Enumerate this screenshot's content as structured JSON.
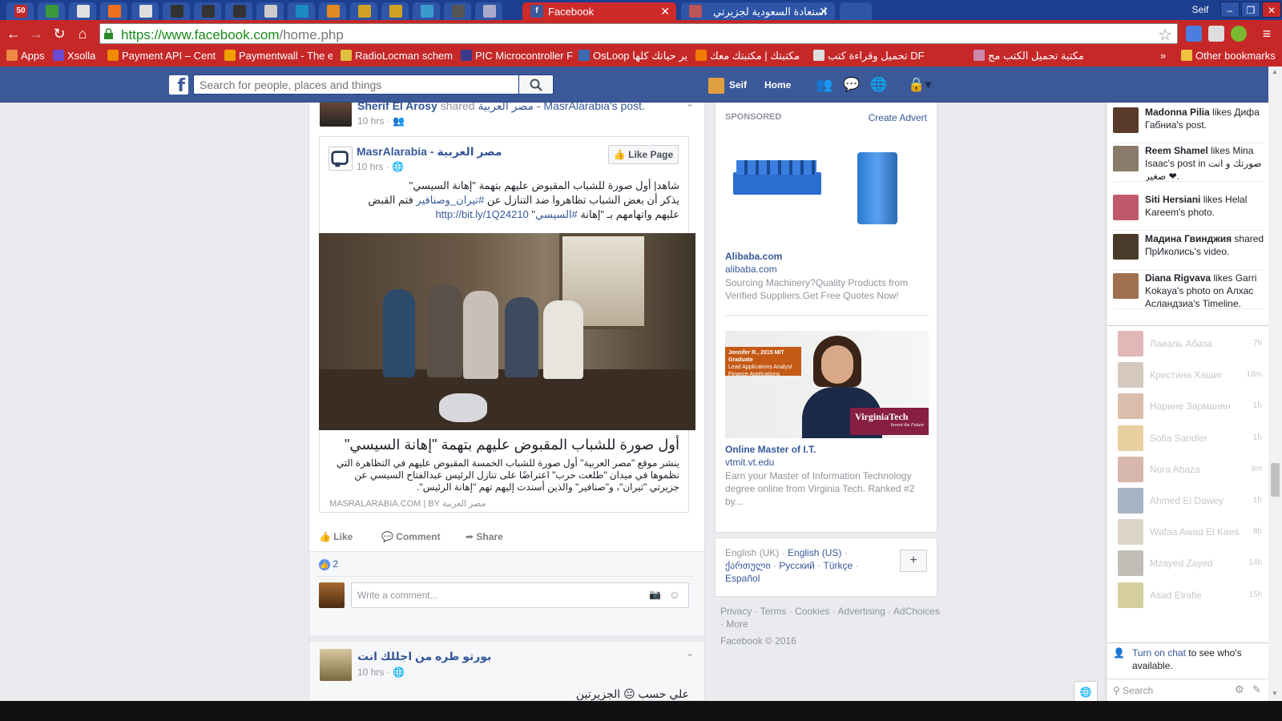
{
  "tabs": {
    "small": [
      "50",
      "",
      "",
      "",
      "",
      "",
      "",
      "",
      "",
      "",
      "",
      "",
      "",
      "",
      "",
      ""
    ],
    "active_tab": "Facebook",
    "second_tab": "استعادة السعودية لجزيرتي",
    "profile": "Seif"
  },
  "toolbar": {
    "url_main": "https://www.facebook.com",
    "url_path": "/home.php"
  },
  "bookmarks": {
    "items": [
      "Apps",
      "Xsolla",
      "Payment API – Centi",
      "Paymentwall - The e",
      "RadioLocman schem",
      "PIC Microcontroller F",
      "OsLoop ير حياتك كلها",
      "مكتبتك | مكتبتك معك",
      "تحميل وقراءة كتب DF",
      "مكتبة تحميل الكتب مج"
    ],
    "overflow": "»",
    "other": "Other bookmarks"
  },
  "fbbar": {
    "search_placeholder": "Search for people, places and things",
    "user": "Seif",
    "home": "Home"
  },
  "feed": {
    "top_story": {
      "author": "Sherif El Arosy",
      "action": "shared",
      "page_link": "مصر العربية - MasrAlarabia",
      "post_suffix": "'s post.",
      "time": "10 hrs"
    },
    "shared": {
      "page": "MasrAlarabia - مصر العربية",
      "time": "10 hrs",
      "like_page": "Like Page",
      "text_line1": "شاهد| أول صورة للشباب المقبوض عليهم بتهمة \"إهانة السيسي\"",
      "text_line2_a": "يذكر أن بعض الشباب تظاهروا ضد التنازل عن ",
      "text_line2_tag": "#تيران_وصنافير",
      "text_line2_b": " فتم القبض",
      "text_line3_a": "عليهم واتهامهم بـ \"إهانة ",
      "text_line3_tag": "#السيسي",
      "text_line3_b": "\" ",
      "text_link": "http://bit.ly/1Q24210",
      "link_title": "أول صورة للشباب المقبوض عليهم بتهمة \"إهانة السيسي\"",
      "link_desc": "ينشر موقع \"مصر العربية\" أول صورة للشباب الخمسة المقبوض عليهم في التظاهرة التي نظموها في ميدان \"طلعت حرب\" اعتراضًا على تنازل الرئيس عبدالفتاح السيسي عن جزيرتي \"تيران\"، و\"صنافير\" والذين أسندت إليهم تهم \"إهانة الرئيس\".",
      "link_domain": "MASRALARABIA.COM",
      "link_by": "BY مصر العربية"
    },
    "actions": {
      "like": "Like",
      "comment": "Comment",
      "share": "Share"
    },
    "likes_count": "2",
    "comment_placeholder": "Write a comment...",
    "next_post": {
      "author": "بورتو طره من اجللك انت",
      "time": "10 hrs",
      "text": "علي حسب 😐 الجزيرتين"
    }
  },
  "sponsored": {
    "label": "SPONSORED",
    "create": "Create Advert",
    "ad1": {
      "title": "Alibaba.com",
      "domain": "alibaba.com",
      "desc": "Sourcing Machinery?Quality Products from Verified Suppliers.Get Free Quotes Now!"
    },
    "ad2": {
      "title": "Online Master of I.T.",
      "domain": "vtmit.vt.edu",
      "desc": "Earn your Master of Information Technology degree online from Virginia Tech. Ranked #2 by...",
      "banner_line1": "Jennifer R., 2015 MIT Graduate",
      "banner_line2": "Lead Applications Analyst",
      "banner_line3": "Finance Applications",
      "brand": "VirginiaTech",
      "tagline": "Invent the Future"
    }
  },
  "languages": {
    "current": "English (UK)",
    "others": [
      "English (US)",
      "ქართული",
      "Русский",
      "Türkçe",
      "Español"
    ]
  },
  "footer": {
    "links": [
      "Privacy",
      "Terms",
      "Cookies",
      "Advertising",
      "AdChoices",
      "More"
    ],
    "copyright": "Facebook © 2016"
  },
  "ticker": [
    {
      "name": "Madonna Pilia",
      "rest": " likes Дифа Габниа's post."
    },
    {
      "name": "Reem Shamel",
      "rest": " likes Mina Isaac's post in صورتك و انت صغير ❤."
    },
    {
      "name": "Siti Hersiani",
      "rest": " likes Helal Kareem's photo."
    },
    {
      "name": "Мадина Гвинджия",
      "rest": " shared ПрИколись's video."
    },
    {
      "name": "Diana Rigvava",
      "rest": " likes Garri Kokaya's photo on Алхас Асландзиа's Timeline."
    }
  ],
  "chat": [
    {
      "name": "Лаиаль Абаза",
      "time": "7h"
    },
    {
      "name": "Кристина Хашиг",
      "time": "18m"
    },
    {
      "name": "Нарине Зарманян",
      "time": "1h"
    },
    {
      "name": "Sofia Sandler",
      "time": "1h"
    },
    {
      "name": "Nora Abaza",
      "time": "9m"
    },
    {
      "name": "Ahmed El Dawey",
      "time": "1h"
    },
    {
      "name": "Wafaa Awad El Kaes",
      "time": "8h"
    },
    {
      "name": "Mzayed Zayed",
      "time": "14h"
    },
    {
      "name": "Asad Elrafie",
      "time": "15h"
    }
  ],
  "chatbar": {
    "turn_on": "Turn on chat",
    "rest": " to see who's available.",
    "search": "Search"
  },
  "colors": {
    "fb_blue": "#3b5998",
    "chrome_red": "#c62828",
    "link": "#365899"
  }
}
